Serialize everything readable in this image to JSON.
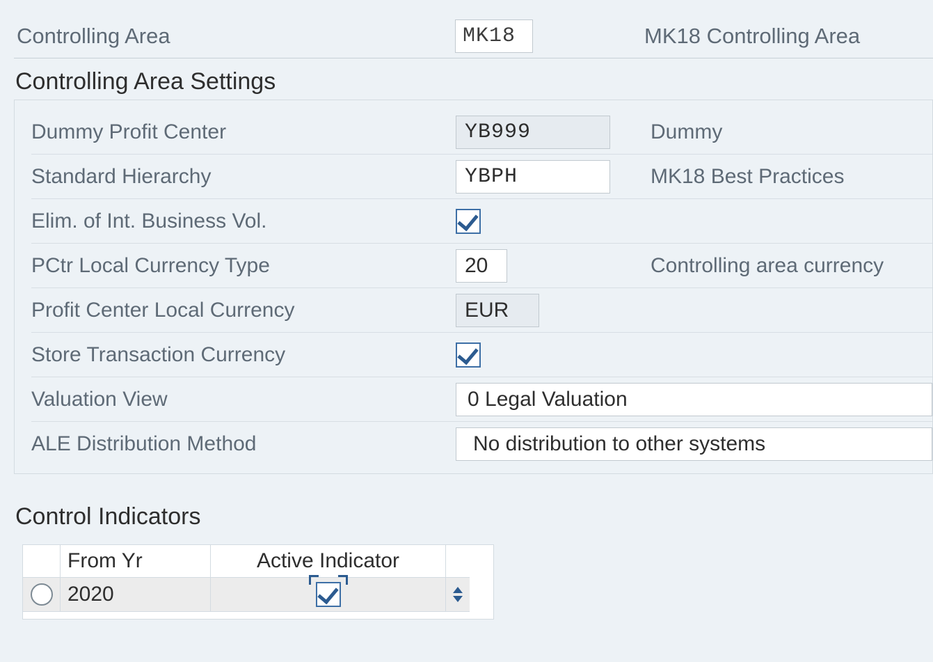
{
  "header": {
    "label": "Controlling Area",
    "value": "MK18",
    "desc": "MK18 Controlling Area"
  },
  "section1": {
    "heading": "Controlling Area Settings",
    "fields": {
      "dummyProfitCenter": {
        "label": "Dummy Profit Center",
        "value": "YB999",
        "desc": "Dummy"
      },
      "standardHierarchy": {
        "label": "Standard Hierarchy",
        "value": "YBPH",
        "desc": "MK18 Best Practices"
      },
      "elimIntBusiness": {
        "label": "Elim. of Int. Business Vol.",
        "checked": true
      },
      "pctrLocalCurrType": {
        "label": "PCtr Local Currency Type",
        "value": "20",
        "desc": "Controlling area currency"
      },
      "profitCenterLocalCurr": {
        "label": "Profit Center Local Currency",
        "value": "EUR"
      },
      "storeTransCurr": {
        "label": "Store Transaction Currency",
        "checked": true
      },
      "valuationView": {
        "label": "Valuation View",
        "value": "0 Legal Valuation"
      },
      "aleDistMethod": {
        "label": "ALE Distribution Method",
        "value": "No distribution to other systems"
      }
    }
  },
  "section2": {
    "heading": "Control Indicators",
    "columns": {
      "fromYr": "From Yr",
      "activeIndicator": "Active Indicator"
    },
    "rows": [
      {
        "fromYr": "2020",
        "active": true
      }
    ]
  }
}
